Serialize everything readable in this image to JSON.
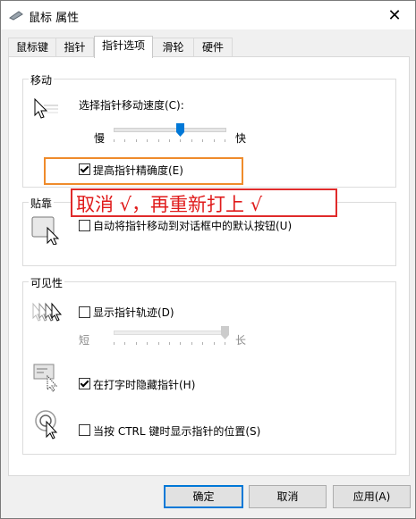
{
  "window": {
    "title": "鼠标 属性",
    "close_label": "✕"
  },
  "tabs": [
    {
      "label": "鼠标键"
    },
    {
      "label": "指针"
    },
    {
      "label": "指针选项"
    },
    {
      "label": "滑轮"
    },
    {
      "label": "硬件"
    }
  ],
  "motion": {
    "group_title": "移动",
    "speed_label": "选择指针移动速度(C):",
    "slow_label": "慢",
    "fast_label": "快",
    "speed_level": 0.6,
    "precision_label": "提高指针精确度(E)",
    "precision_checked": true
  },
  "annotation": {
    "text": "取消 √，再重新打上 √"
  },
  "snap": {
    "group_title": "贴靠",
    "snap_label": "自动将指针移动到对话框中的默认按钮(U)",
    "snap_checked": false
  },
  "visibility": {
    "group_title": "可见性",
    "trails_label": "显示指针轨迹(D)",
    "trails_checked": false,
    "short_label": "短",
    "long_label": "长",
    "trails_level": 1.0,
    "hide_label": "在打字时隐藏指针(H)",
    "hide_checked": true,
    "ctrl_label": "当按 CTRL 键时显示指针的位置(S)",
    "ctrl_checked": false
  },
  "buttons": {
    "ok": "确定",
    "cancel": "取消",
    "apply": "应用(A)"
  },
  "colors": {
    "accent": "#0078d7",
    "highlight_orange": "#ef8b2b",
    "annotation_red": "#e01b1b"
  }
}
